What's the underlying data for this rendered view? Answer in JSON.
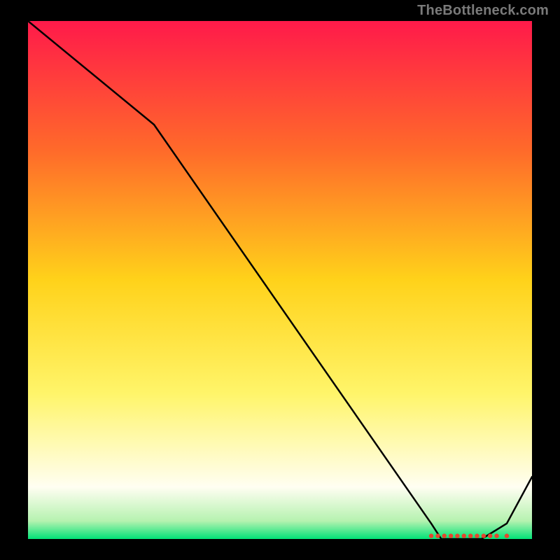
{
  "watermark": "TheBottleneck.com",
  "chart_data": {
    "type": "line",
    "title": "",
    "xlabel": "",
    "ylabel": "",
    "xlim": [
      0,
      100
    ],
    "ylim": [
      0,
      100
    ],
    "grid": false,
    "legend": false,
    "background_gradient_top": "#ff1a4a",
    "background_gradient_bottom": "#00e277",
    "gradient_stops": [
      {
        "offset": 0.0,
        "color": "#ff1a4a"
      },
      {
        "offset": 0.25,
        "color": "#ff6a2a"
      },
      {
        "offset": 0.5,
        "color": "#ffd21a"
      },
      {
        "offset": 0.72,
        "color": "#fff56a"
      },
      {
        "offset": 0.9,
        "color": "#fffef2"
      },
      {
        "offset": 0.965,
        "color": "#b6f2b0"
      },
      {
        "offset": 1.0,
        "color": "#00e277"
      }
    ],
    "series": [
      {
        "name": "curve",
        "color": "#000000",
        "x": [
          0,
          25,
          80,
          82,
          90,
          95,
          100
        ],
        "y": [
          100,
          80,
          3,
          0,
          0,
          3,
          12
        ]
      }
    ],
    "markers": {
      "name": "bottom-cluster",
      "color": "#e4452f",
      "points_x": [
        80,
        81.3,
        82.6,
        83.9,
        85.2,
        86.5,
        87.8,
        89.1,
        90.4,
        91.7,
        93,
        95
      ],
      "points_y": [
        0.6,
        0.6,
        0.6,
        0.6,
        0.6,
        0.6,
        0.6,
        0.6,
        0.6,
        0.6,
        0.6,
        0.6
      ]
    }
  }
}
